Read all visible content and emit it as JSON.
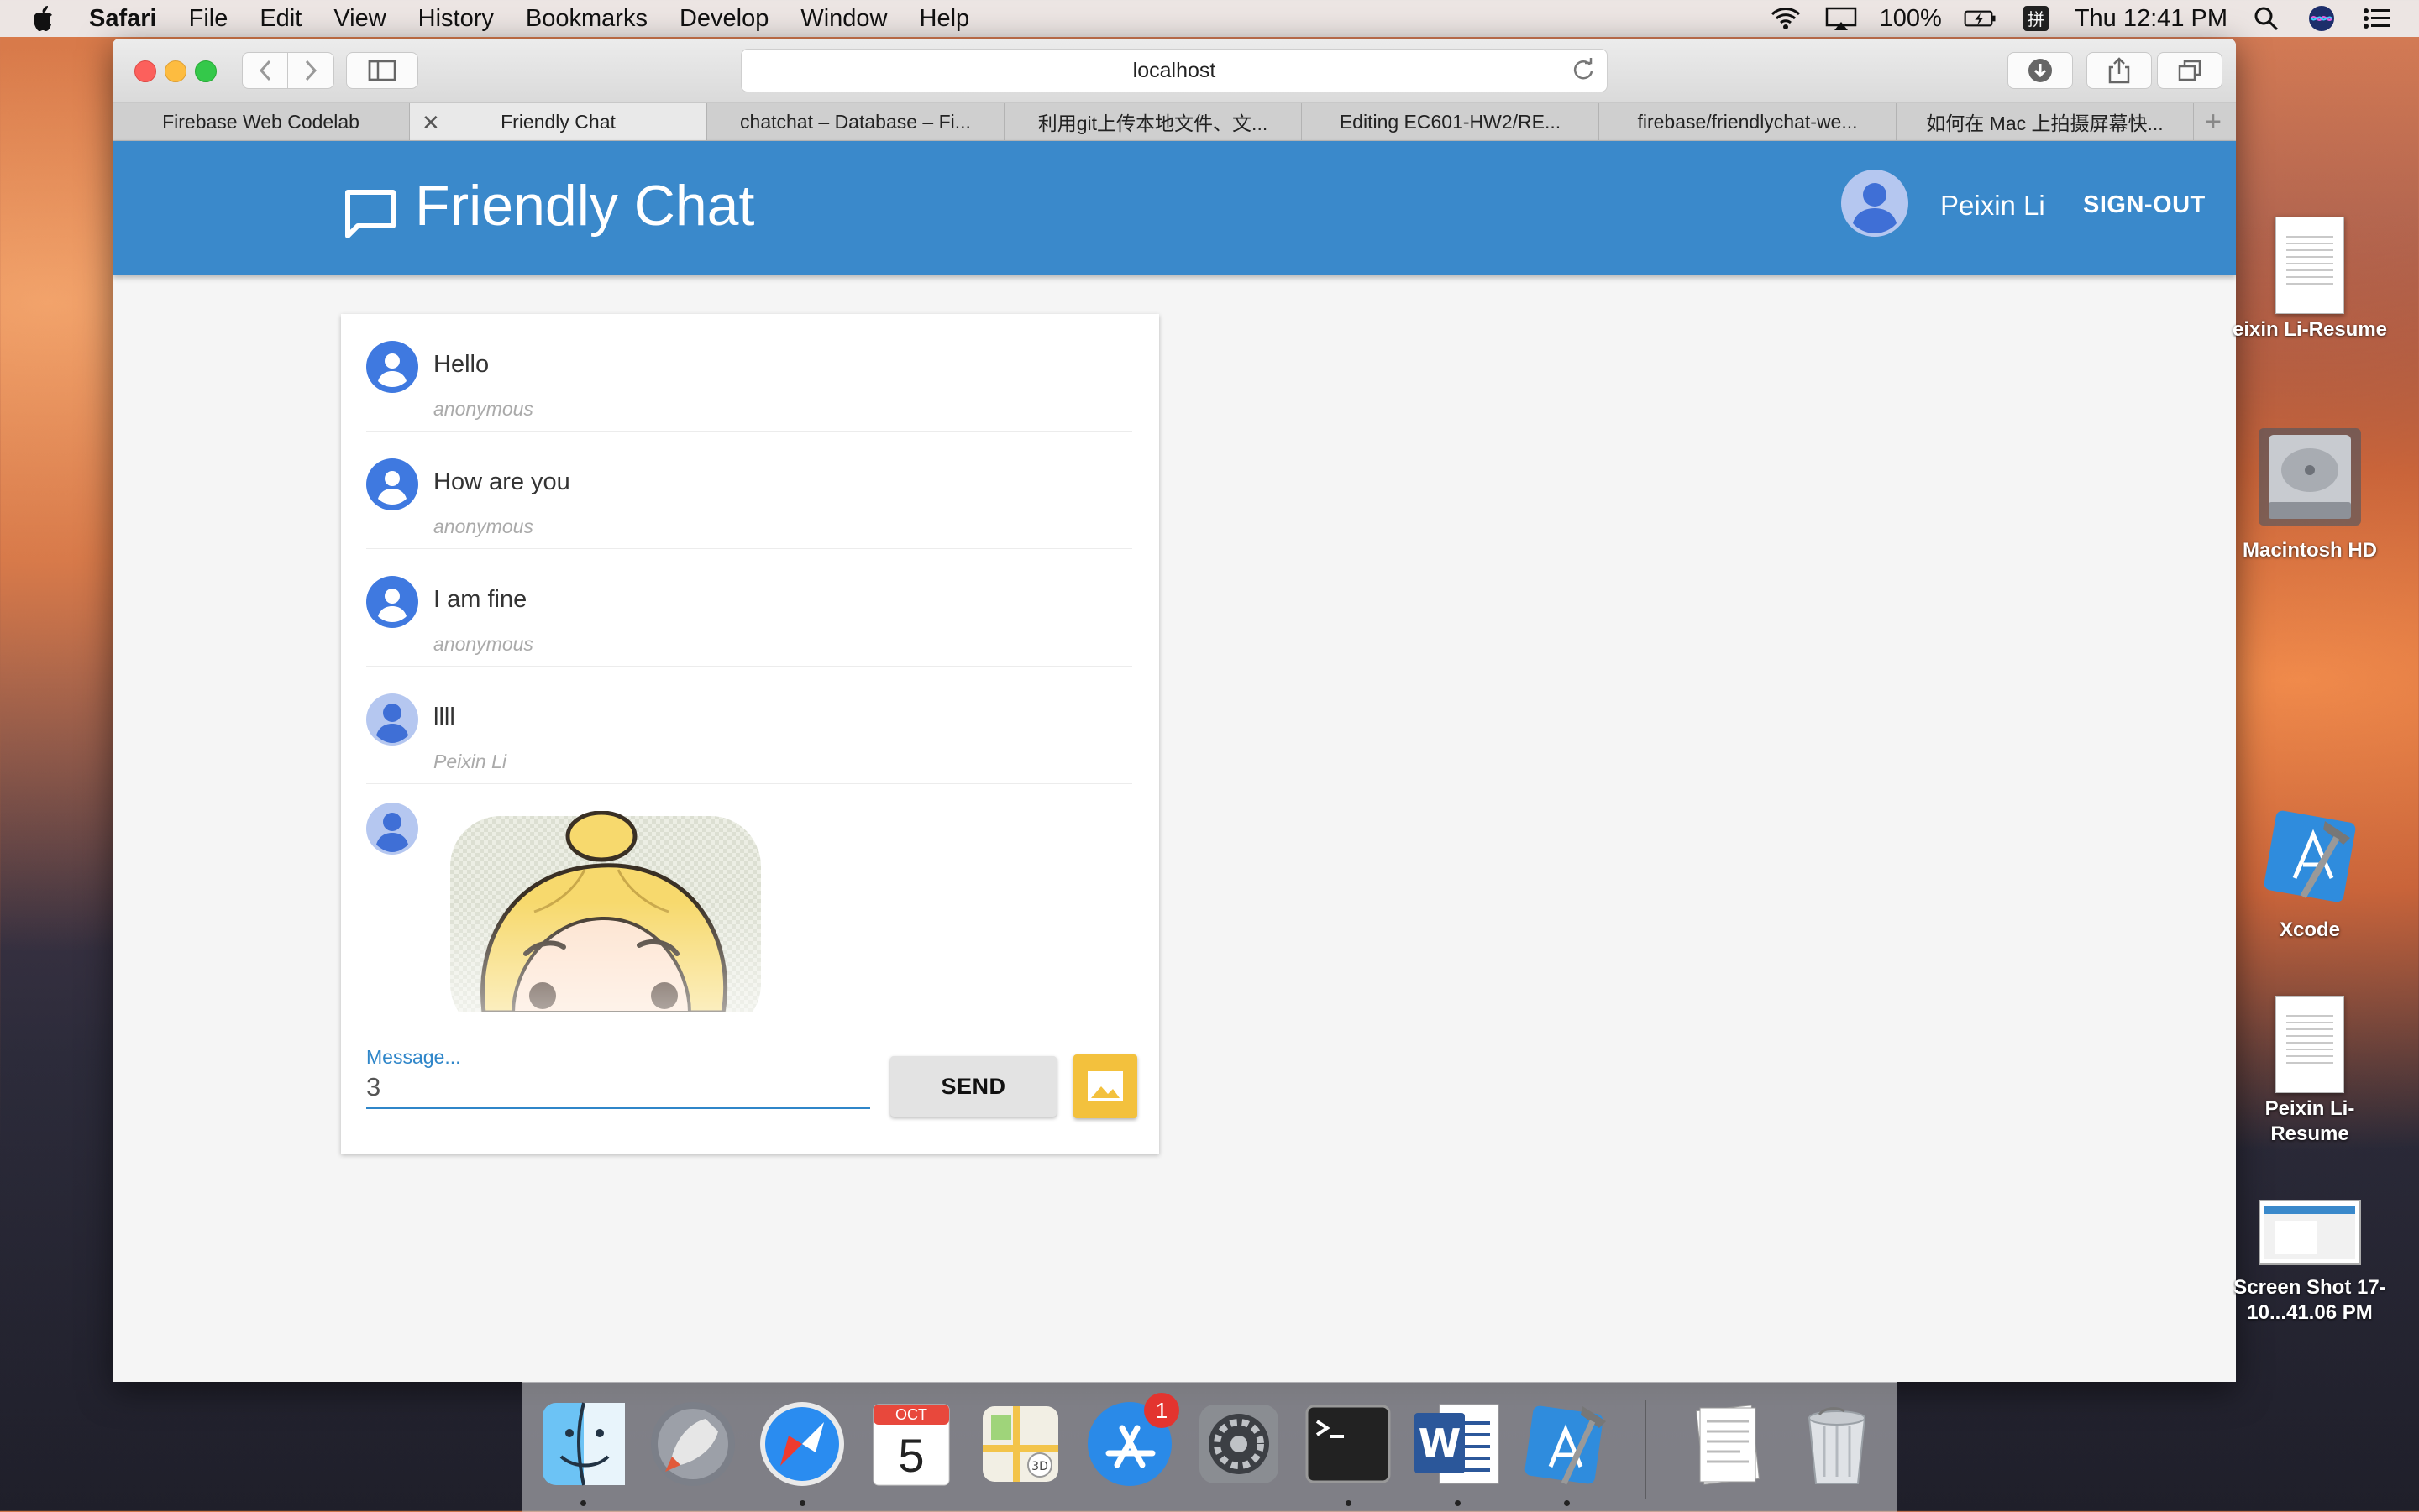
{
  "menubar": {
    "app_name": "Safari",
    "items": [
      "File",
      "Edit",
      "View",
      "History",
      "Bookmarks",
      "Develop",
      "Window",
      "Help"
    ],
    "battery": "100%",
    "clock": "Thu 12:41 PM"
  },
  "browser": {
    "url": "localhost",
    "tabs": [
      {
        "label": "Firebase Web Codelab"
      },
      {
        "label": "Friendly Chat"
      },
      {
        "label": "chatchat – Database – Fi..."
      },
      {
        "label": "利用git上传本地文件、文..."
      },
      {
        "label": "Editing EC601-HW2/RE..."
      },
      {
        "label": "firebase/friendlychat-we..."
      },
      {
        "label": "如何在 Mac 上拍摄屏幕快..."
      }
    ]
  },
  "app": {
    "title": "Friendly Chat",
    "user_name": "Peixin Li",
    "signout_label": "SIGN-OUT",
    "header_color": "#3a89cb"
  },
  "messages": [
    {
      "text": "Hello",
      "author": "anonymous"
    },
    {
      "text": "How are you",
      "author": "anonymous"
    },
    {
      "text": "I am fine",
      "author": "anonymous"
    },
    {
      "text": "llll",
      "author": "Peixin Li"
    }
  ],
  "composer": {
    "label": "Message...",
    "value": "3",
    "send_label": "SEND"
  },
  "desktop": {
    "items": [
      {
        "label": "eixin Li-Resume"
      },
      {
        "label": "Macintosh HD"
      },
      {
        "label": "Xcode"
      },
      {
        "label": "Peixin Li-Resume"
      },
      {
        "label": "Screen Shot 17-10...41.06 PM"
      }
    ]
  },
  "dock": {
    "calendar_month": "OCT",
    "calendar_day": "5",
    "appstore_badge": "1"
  }
}
